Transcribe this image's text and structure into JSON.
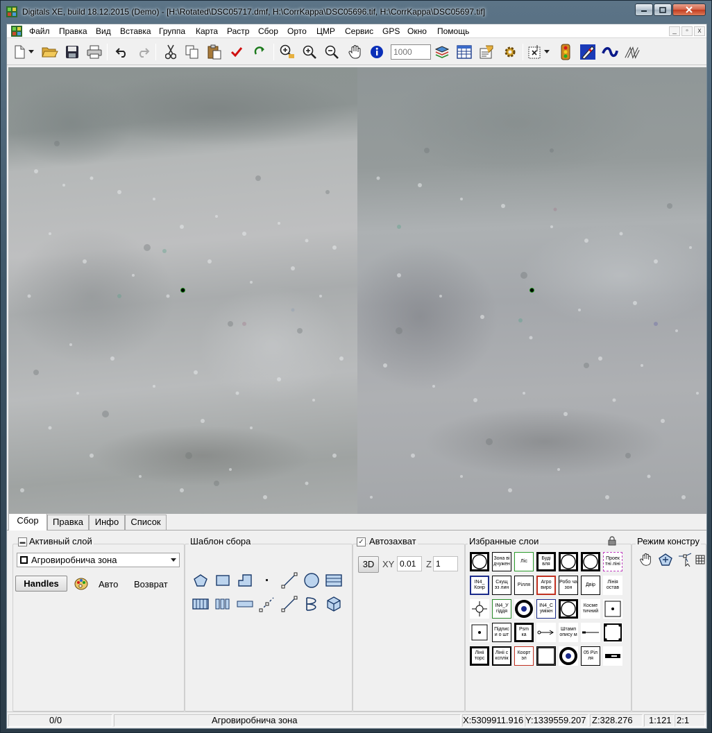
{
  "window": {
    "title": "Digitals XE, build 18.12.2015 (Demo) - [H:\\Rotated\\DSC05717.dmf, H:\\CorrKappa\\DSC05696.tif, H:\\CorrKappa\\DSC05697.tif]",
    "caption_buttons": [
      "minimize",
      "maximize",
      "close"
    ]
  },
  "menu": {
    "items": [
      "Файл",
      "Правка",
      "Вид",
      "Вставка",
      "Группа",
      "Карта",
      "Растр",
      "Сбор",
      "Орто",
      "ЦМР",
      "Сервис",
      "GPS",
      "Окно",
      "Помощь"
    ],
    "mdi_buttons": [
      "_",
      "▫",
      "x"
    ]
  },
  "toolbar": {
    "scale_placeholder": "1000",
    "icons": [
      "new-file-icon",
      "open-folder-icon",
      "save-icon",
      "print-icon",
      "undo-icon",
      "redo-icon",
      "cut-icon",
      "copy-icon",
      "paste-icon",
      "check-icon",
      "refresh-icon",
      "zoom-window-icon",
      "zoom-in-icon",
      "zoom-out-icon",
      "pan-hand-icon",
      "info-icon",
      "layers-icon",
      "table-icon",
      "properties-icon",
      "settings-gear-icon",
      "select-tool-icon",
      "traffic-light-icon",
      "pencil-icon",
      "curve-icon",
      "lines-icon"
    ]
  },
  "tabs": [
    {
      "label": "Сбор",
      "active": true
    },
    {
      "label": "Правка",
      "active": false
    },
    {
      "label": "Инфо",
      "active": false
    },
    {
      "label": "Список",
      "active": false
    }
  ],
  "active_layer": {
    "title": "Активный слой",
    "selected": "Агровиробнича зона",
    "handles_label": "Handles",
    "auto_label": "Авто",
    "return_label": "Возврат"
  },
  "template": {
    "title": "Шаблон сбора",
    "tools": [
      "polygon-icon",
      "rectangle-icon",
      "orthogonal-polygon-icon",
      "point-icon",
      "line-icon",
      "circle-icon",
      "hatch-rect-icon",
      "grid-rect-icon",
      "triple-bar-icon",
      "double-line-icon",
      "dashed-line-icon",
      "dotted-line-icon",
      "bezier-icon",
      "cube-icon"
    ]
  },
  "autosnap": {
    "title": "Автозахват",
    "checked": true,
    "btn_3d": "3D",
    "xy_label": "XY",
    "xy_value": "0.01",
    "z_label": "Z",
    "z_value": "1"
  },
  "favorites": {
    "title": "Избранные слои",
    "items": [
      {
        "text": "",
        "icon": "circle-square-icon"
      },
      {
        "text": "Зона вi дчужен",
        "icon": ""
      },
      {
        "text": "Лiс",
        "icon": ""
      },
      {
        "text": "Будi вля",
        "icon": ""
      },
      {
        "text": "",
        "icon": "circle-square-icon"
      },
      {
        "text": "",
        "icon": "circle-square-icon"
      },
      {
        "text": "Проек тнi лiнi",
        "icon": ""
      },
      {
        "text": "IN4_ Кoнр",
        "icon": ""
      },
      {
        "text": "Скущ эз лин",
        "icon": ""
      },
      {
        "text": "Рiлля",
        "icon": ""
      },
      {
        "text": "Агро виро",
        "icon": ""
      },
      {
        "text": "Робо ча зон",
        "icon": ""
      },
      {
        "text": "Двiр",
        "icon": ""
      },
      {
        "text": "Лiнiя остав",
        "icon": ""
      },
      {
        "text": "",
        "icon": "crosshair-icon"
      },
      {
        "text": "IN4_У гiддя",
        "icon": ""
      },
      {
        "text": "",
        "icon": "target-icon"
      },
      {
        "text": "IN4_C умiжн",
        "icon": ""
      },
      {
        "text": "",
        "icon": "circle-square-icon"
      },
      {
        "text": "Косме тичний",
        "icon": ""
      },
      {
        "text": "",
        "icon": "dot-square-icon"
      },
      {
        "text": "",
        "icon": "dot-square-icon"
      },
      {
        "text": "Пiдпис и о шт",
        "icon": ""
      },
      {
        "text": "Psm ка",
        "icon": ""
      },
      {
        "text": "",
        "icon": "arrow-line-icon"
      },
      {
        "text": "Штамп описy м",
        "icon": ""
      },
      {
        "text": "",
        "icon": "dash-line-icon"
      },
      {
        "text": "",
        "icon": "corner-square-icon"
      },
      {
        "text": "Лiнii торс",
        "icon": ""
      },
      {
        "text": "Лiнii с ксплiк",
        "icon": ""
      },
      {
        "text": "Коорт эл",
        "icon": ""
      },
      {
        "text": "",
        "icon": "empty-square-icon"
      },
      {
        "text": "",
        "icon": "target-icon"
      },
      {
        "text": "05 Рiл ля",
        "icon": ""
      },
      {
        "text": "",
        "icon": "dash-bar-icon"
      }
    ]
  },
  "construct_mode": {
    "title": "Режим констру",
    "tools": [
      "hand-icon",
      "polygon-plus-icon",
      "node-select-icon",
      "table-grid-icon"
    ]
  },
  "status": {
    "count": "0/0",
    "layer": "Агровиробнича зона",
    "x": "X:5309911.916",
    "y": "Y:1339559.207",
    "z": "Z:328.276",
    "scale": "1:121",
    "zoom": "2:1"
  },
  "colors": {
    "title_bar": "#3d5567",
    "panel_bg": "#f0f0f0",
    "cursor": "#1a8a1a",
    "info_icon": "#0a2fb8",
    "check_icon": "#d01010"
  }
}
